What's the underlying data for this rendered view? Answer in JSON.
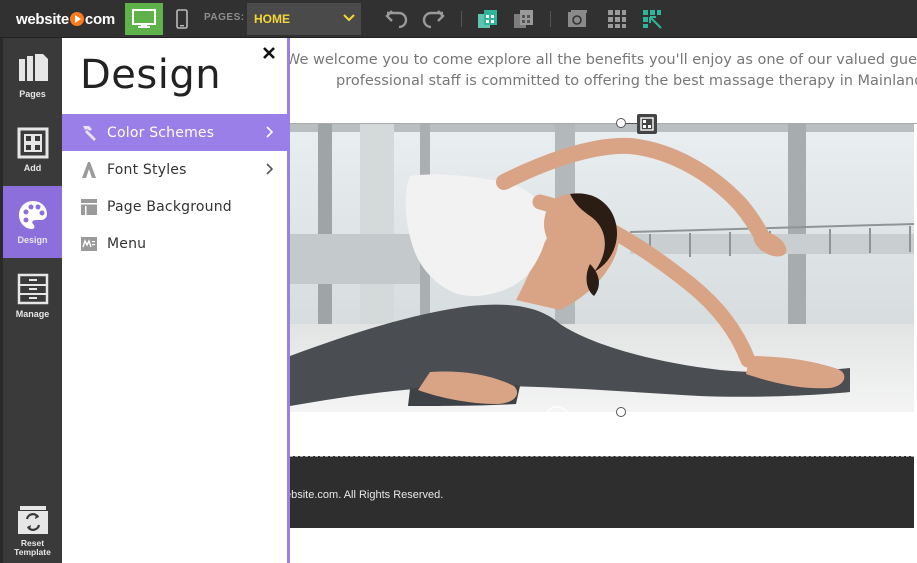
{
  "app": {
    "logo_left": "website",
    "logo_right": "com"
  },
  "toolbar": {
    "pages_label": "PAGES:",
    "current_page": "HOME"
  },
  "rail": {
    "items": [
      {
        "label": "Pages",
        "icon": "pages-icon"
      },
      {
        "label": "Add",
        "icon": "add-icon"
      },
      {
        "label": "Design",
        "icon": "palette-icon"
      },
      {
        "label": "Manage",
        "icon": "manage-icon"
      }
    ],
    "reset_line1": "Reset",
    "reset_line2": "Template"
  },
  "panel": {
    "title": "Design",
    "items": [
      {
        "label": "Color Schemes",
        "icon": "hammer-icon",
        "has_submenu": true,
        "active": true
      },
      {
        "label": "Font Styles",
        "icon": "font-icon",
        "has_submenu": true,
        "active": false
      },
      {
        "label": "Page Background",
        "icon": "background-icon",
        "has_submenu": false,
        "active": false
      },
      {
        "label": "Menu",
        "icon": "menu-icon",
        "has_submenu": false,
        "active": false
      }
    ]
  },
  "canvas": {
    "welcome_line1": "We welcome you to come explore all the benefits you'll enjoy as one of our valued guests",
    "welcome_line2": "professional staff is committed to offering the best massage therapy in Mainland.",
    "footer_text": "ebsite.com. All Rights Reserved."
  },
  "colors": {
    "accent": "#9b7fe8",
    "rail_active": "#8c6fdb",
    "device_active": "#5fb14a",
    "page_select_text": "#f5d63b",
    "topbar": "#313131",
    "rail_bg": "#3a3a3a",
    "footer_bg": "#2e2e2e",
    "toolbar_teal": "#2fb59a"
  }
}
